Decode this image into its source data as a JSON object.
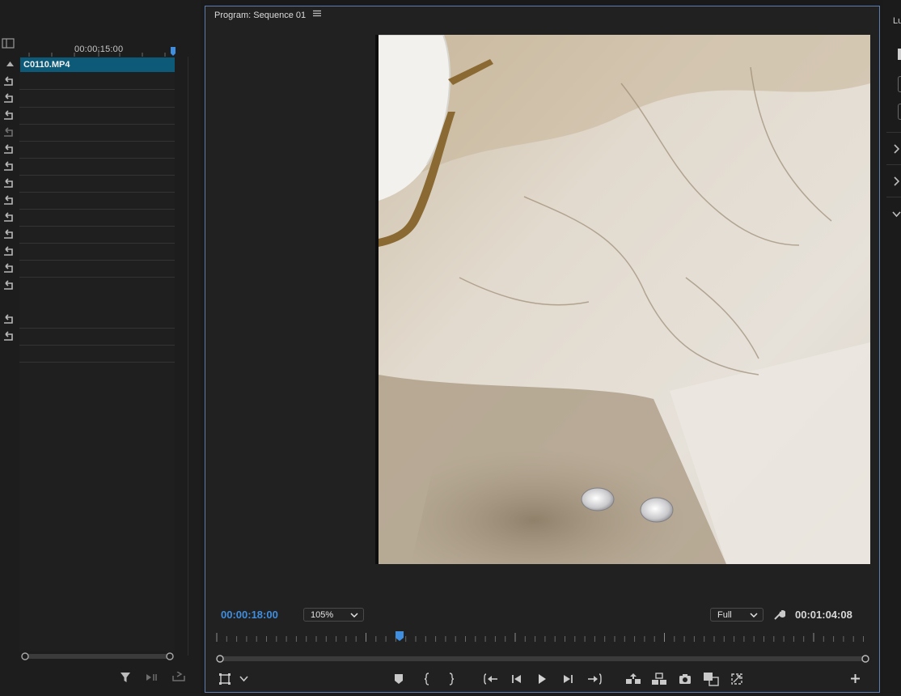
{
  "timeline": {
    "ruler_time": "00:00:15:00",
    "clip_name": "C0110.MP4"
  },
  "monitor": {
    "title": "Program: Sequence 01",
    "menu_icon": "hamburger-icon",
    "current_timecode": "00:00:18:00",
    "zoom_level": "105%",
    "resolution": "Full",
    "duration_timecode": "00:01:04:08",
    "playhead_fraction": 0.28
  },
  "right_panel": {
    "label": "Lu"
  },
  "colors": {
    "accent_blue": "#3f8ee0",
    "clip_teal": "#0c5a78",
    "panel_border": "#5c7dae"
  },
  "transport_icons": [
    "add-marker-icon",
    "mark-in-icon",
    "mark-out-icon",
    "go-to-in-icon",
    "step-back-icon",
    "play-icon",
    "step-forward-icon",
    "go-to-out-icon",
    "lift-icon",
    "extract-icon",
    "export-frame-icon",
    "comparison-view-icon",
    "toggle-proxies-icon",
    "add-button-icon"
  ]
}
